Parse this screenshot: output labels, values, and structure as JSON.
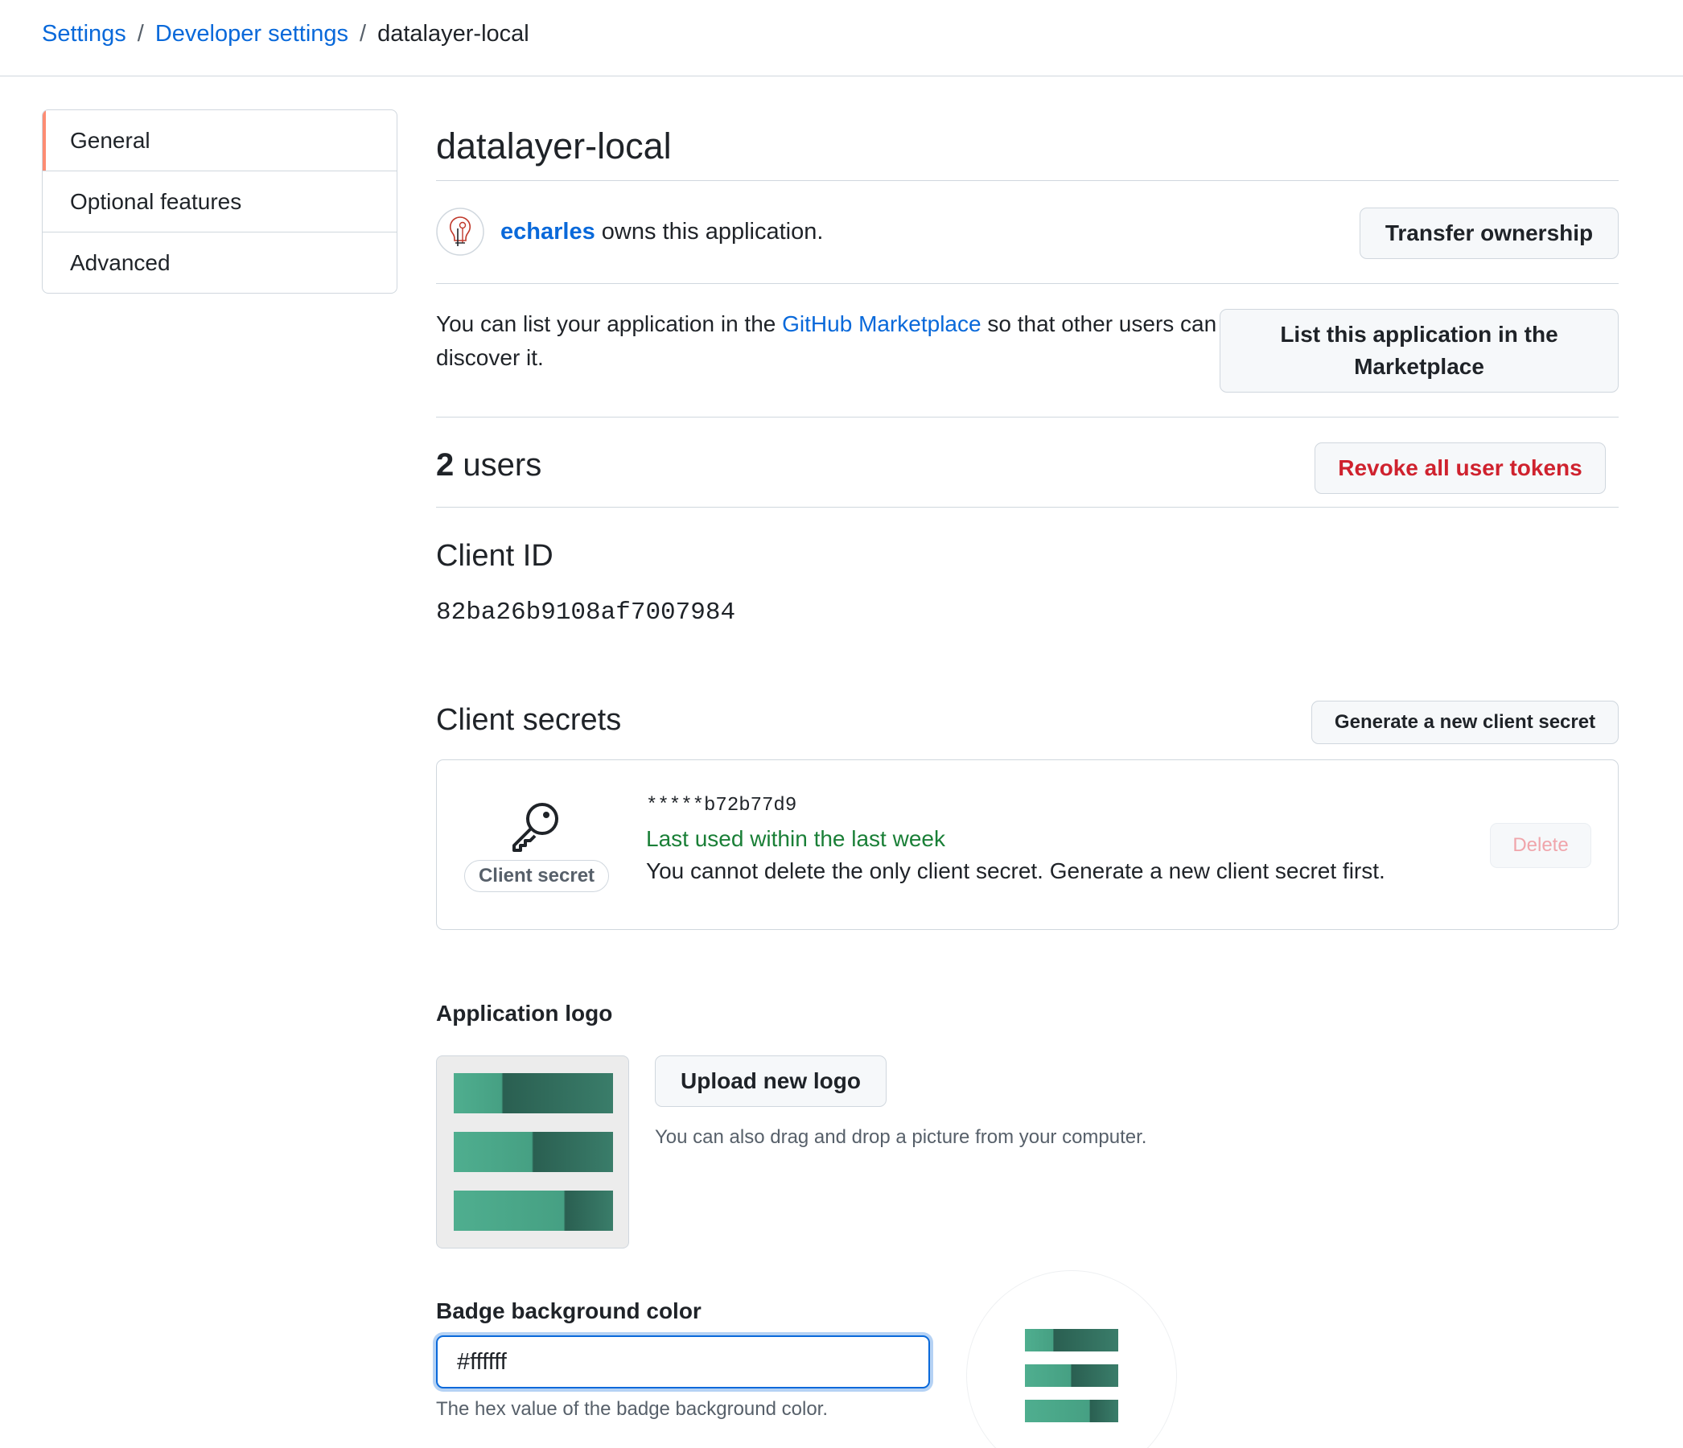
{
  "breadcrumb": {
    "settings": "Settings",
    "developer_settings": "Developer settings",
    "current": "datalayer-local",
    "separator": "/"
  },
  "sidebar": {
    "items": [
      {
        "label": "General",
        "selected": true
      },
      {
        "label": "Optional features",
        "selected": false
      },
      {
        "label": "Advanced",
        "selected": false
      }
    ]
  },
  "app": {
    "title": "datalayer-local",
    "owner_name": "echarles",
    "owner_suffix": "owns this application.",
    "transfer_label": "Transfer ownership"
  },
  "marketplace": {
    "text_before": "You can list your application in the",
    "link": "GitHub Marketplace",
    "text_after": "so that other users can discover it.",
    "button_line1": "List this application in the",
    "button_line2": "Marketplace"
  },
  "users": {
    "count": "2",
    "label": "users",
    "revoke_label": "Revoke all user tokens"
  },
  "client_id": {
    "title": "Client ID",
    "value": "82ba26b9108af7007984"
  },
  "client_secrets": {
    "title": "Client secrets",
    "generate_label": "Generate a new client secret",
    "pill_label": "Client secret",
    "masked": "*****b72b77d9",
    "last_used": "Last used within the last week",
    "warning": "You cannot delete the only client secret. Generate a new client secret first.",
    "delete_label": "Delete"
  },
  "logo": {
    "title": "Application logo",
    "upload_label": "Upload new logo",
    "hint": "You can also drag and drop a picture from your computer."
  },
  "badge": {
    "title": "Badge background color",
    "value": "#ffffff",
    "hint": "The hex value of the badge background color."
  },
  "colors": {
    "link": "#0969da",
    "danger": "#cf222e",
    "success": "#1a7f37",
    "accent_nav": "#fd8c73",
    "logo_light": "#4fae8f",
    "logo_dark": "#2a5f51"
  },
  "icons": {
    "key": "key-icon",
    "avatar": "user-avatar-icon"
  }
}
